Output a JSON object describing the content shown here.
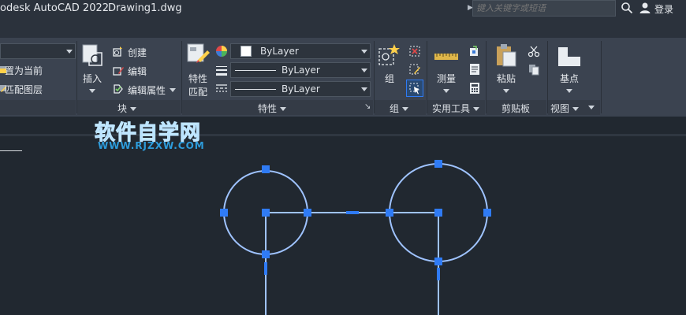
{
  "titlebar": {
    "app_title": "odesk AutoCAD 2022",
    "file_title": "Drawing1.dwg",
    "search_placeholder": "键入关键字或短语",
    "login_label": "登录"
  },
  "ribbon": {
    "layer_panel": {
      "item_set_current": "置为当前",
      "item_match_layer": "匹配图层"
    },
    "block_panel": {
      "insert_label": "插入",
      "create_label": "创建",
      "edit_label": "编辑",
      "edit_attributes_label": "编辑属性",
      "footer_label": "块"
    },
    "properties_panel": {
      "match_properties_label_line1": "特性",
      "match_properties_label_line2": "匹配",
      "color_value": "ByLayer",
      "linetype_value": "ByLayer",
      "lineweight_value": "ByLayer",
      "footer_label": "特性"
    },
    "groups_panel": {
      "group_label": "组",
      "footer_label": "组"
    },
    "utilities_panel": {
      "measure_label": "测量",
      "footer_label": "实用工具"
    },
    "clipboard_panel": {
      "paste_label": "粘贴",
      "footer_label": "剪贴板"
    },
    "view_panel": {
      "base_label": "基点",
      "footer_label": "视图"
    }
  },
  "watermark": {
    "text": "软件自学网",
    "url": "WWW.RJZXW.COM"
  },
  "colors": {
    "accent_blue": "#2f7bf5",
    "selected_line": "#9fc3ff",
    "ribbon_bg": "#3b4350",
    "canvas_bg": "#212830"
  }
}
